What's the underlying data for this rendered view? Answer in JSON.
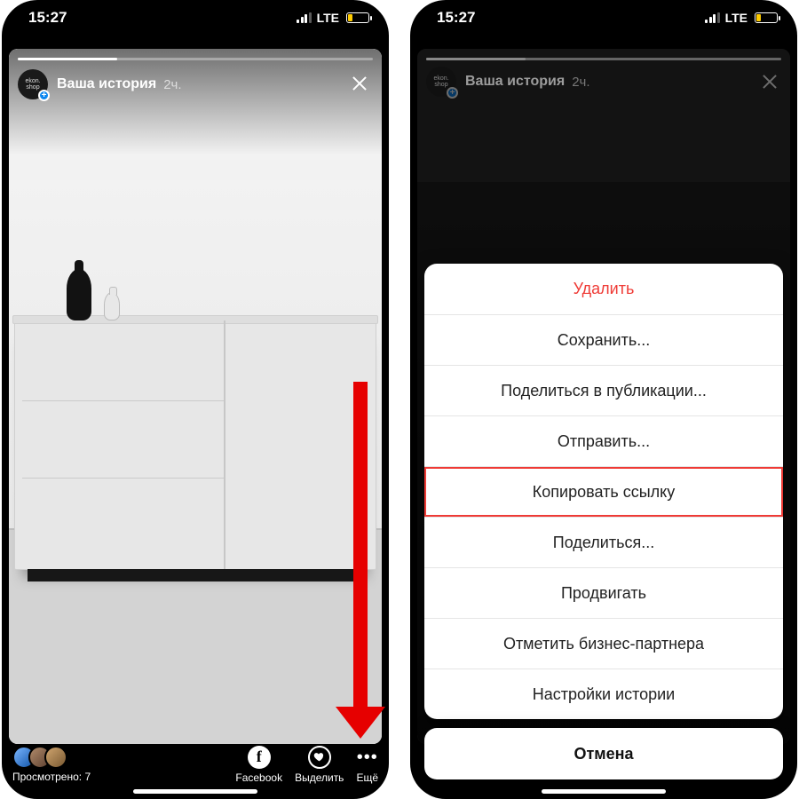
{
  "status": {
    "time": "15:27",
    "network": "LTE"
  },
  "story": {
    "title": "Ваша история",
    "elapsed": "2ч.",
    "avatar_label": "ekon.\nshop"
  },
  "bottom": {
    "views_label": "Просмотрено: 7",
    "facebook": "Facebook",
    "highlight": "Выделить",
    "more": "Ещё",
    "fb_glyph": "f"
  },
  "sheet": {
    "items": [
      {
        "label": "Удалить",
        "destructive": true
      },
      {
        "label": "Сохранить..."
      },
      {
        "label": "Поделиться в публикации..."
      },
      {
        "label": "Отправить..."
      },
      {
        "label": "Копировать ссылку",
        "highlight": true
      },
      {
        "label": "Поделиться..."
      },
      {
        "label": "Продвигать"
      },
      {
        "label": "Отметить бизнес-партнера"
      },
      {
        "label": "Настройки истории"
      }
    ],
    "cancel": "Отмена"
  }
}
